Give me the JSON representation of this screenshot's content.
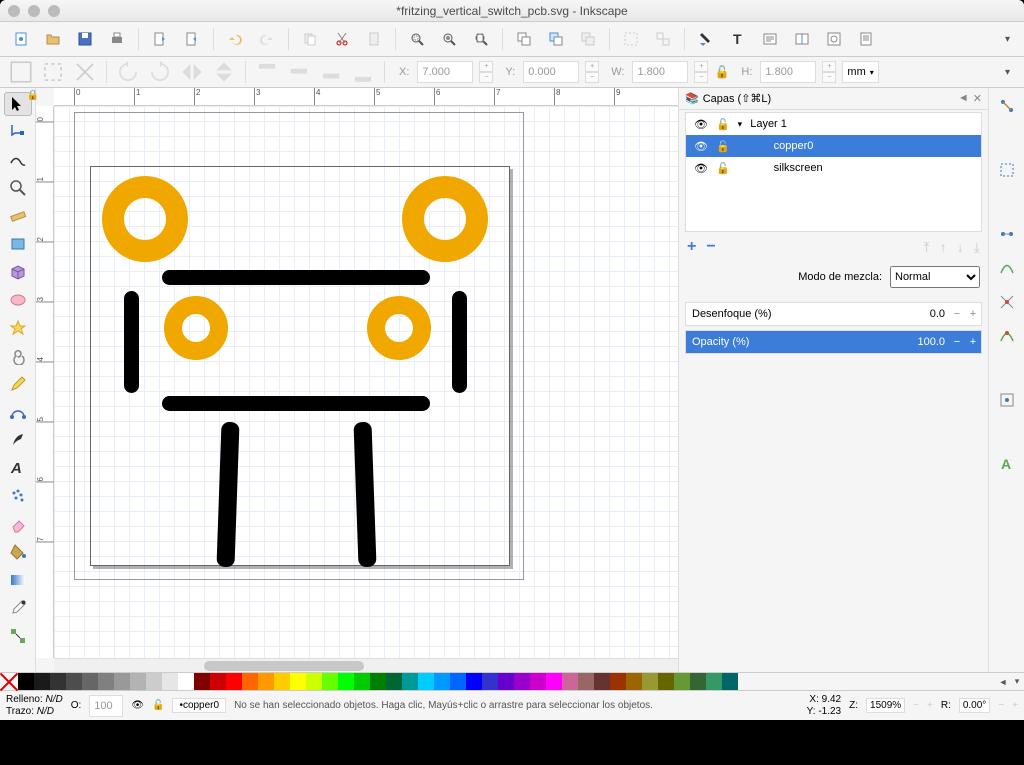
{
  "window": {
    "title": "*fritzing_vertical_switch_pcb.svg - Inkscape"
  },
  "propbar": {
    "x_label": "X:",
    "x": "7.000",
    "y_label": "Y:",
    "y": "0.000",
    "w_label": "W:",
    "w": "1.800",
    "h_label": "H:",
    "h": "1.800",
    "units": "mm"
  },
  "ruler_h": [
    "0",
    "1",
    "2",
    "3",
    "4",
    "5",
    "6",
    "7",
    "8",
    "9"
  ],
  "ruler_v": [
    "0",
    "1",
    "2",
    "3",
    "4",
    "5",
    "6",
    "7"
  ],
  "layers_panel": {
    "title": "Capas (⇧⌘L)",
    "layers": [
      {
        "name": "Layer 1",
        "selected": false,
        "indent": 0,
        "expand": true
      },
      {
        "name": "copper0",
        "selected": true,
        "indent": 1,
        "expand": false
      },
      {
        "name": "silkscreen",
        "selected": false,
        "indent": 1,
        "expand": false
      }
    ],
    "blend_label": "Modo de mezcla:",
    "blend_value": "Normal",
    "blur_label": "Desenfoque (%)",
    "blur_value": "0.0",
    "opacity_label": "Opacity (%)",
    "opacity_value": "100.0"
  },
  "status": {
    "fill_label": "Relleno:",
    "fill_value": "N/D",
    "stroke_label": "Trazo:",
    "stroke_value": "N/D",
    "o_label": "O:",
    "o_value": "100",
    "layer_label": "•copper0",
    "message": "No se han seleccionado objetos. Haga clic, Mayús+clic o arrastre para seleccionar los objetos.",
    "x_label": "X:",
    "x": "9.42",
    "y_label": "Y:",
    "y": "-1.23",
    "z_label": "Z:",
    "z": "1509%",
    "r_label": "R:",
    "r": "0.00°"
  },
  "palette_colors": [
    "#000000",
    "#1a1a1a",
    "#333333",
    "#4d4d4d",
    "#666666",
    "#808080",
    "#999999",
    "#b3b3b3",
    "#cccccc",
    "#e6e6e6",
    "#ffffff",
    "#800000",
    "#cc0000",
    "#ff0000",
    "#ff6600",
    "#ff9900",
    "#ffcc00",
    "#ffff00",
    "#ccff00",
    "#66ff00",
    "#00ff00",
    "#00cc00",
    "#008000",
    "#006633",
    "#009999",
    "#00ccff",
    "#0099ff",
    "#0066ff",
    "#0000ff",
    "#3333cc",
    "#6600cc",
    "#9900cc",
    "#cc00cc",
    "#ff00ff",
    "#cc6699",
    "#996666",
    "#663333",
    "#993300",
    "#996600",
    "#999933",
    "#666600",
    "#669933",
    "#336633",
    "#339966",
    "#006666"
  ]
}
